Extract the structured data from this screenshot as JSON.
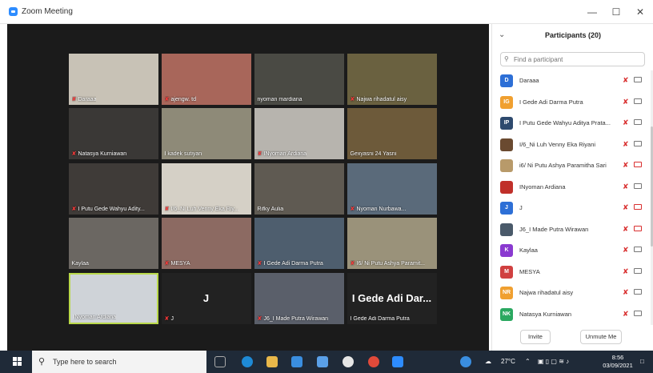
{
  "window": {
    "title": "Zoom Meeting",
    "minimize": "—",
    "maximize": "☐",
    "close": "✕"
  },
  "tiles": [
    {
      "name": "Daraaa",
      "muted": true,
      "bg": "#c8c2b6"
    },
    {
      "name": "ajengw. td",
      "muted": true,
      "bg": "#a8665a"
    },
    {
      "name": "nyoman mardiana",
      "muted": false,
      "bg": "#4a4a44"
    },
    {
      "name": "Najwa rihadatul aisy",
      "muted": true,
      "bg": "#6a6140"
    },
    {
      "name": "Natasya Kurniawan",
      "muted": true,
      "bg": "#3a3836"
    },
    {
      "name": "I kadek sutiyan",
      "muted": false,
      "bg": "#8e8a78"
    },
    {
      "name": "INyoman Ardiana",
      "muted": true,
      "bg": "#b7b4ae"
    },
    {
      "name": "Gexyasni 24 Yasni",
      "muted": false,
      "bg": "#6d5a3a"
    },
    {
      "name": "I Putu Gede Wahyu Adity...",
      "muted": true,
      "bg": "#3f3b38"
    },
    {
      "name": "I/6_Ni Luh Venny Eka Riy...",
      "muted": true,
      "bg": "#d5d0c6"
    },
    {
      "name": "Rifky Aulia",
      "muted": false,
      "bg": "#5f5a52"
    },
    {
      "name": "Nyoman Nurbawa...",
      "muted": true,
      "bg": "#5a6a7a"
    },
    {
      "name": "Kaylaa",
      "muted": false,
      "bg": "#6b6762"
    },
    {
      "name": "MESYA",
      "muted": true,
      "bg": "#8c6a62"
    },
    {
      "name": "I Gede Adi Darma Putra",
      "muted": true,
      "bg": "#4e5e6e"
    },
    {
      "name": "I6/ Ni Putu Ashya Paramit...",
      "muted": true,
      "bg": "#9a927a"
    },
    {
      "name": "INyoman Ardiana",
      "muted": false,
      "bg": "#cfd3d8",
      "active": true
    },
    {
      "name": "J",
      "muted": true,
      "bg": "#222222",
      "big": "J"
    },
    {
      "name": "J6_I Made Putra Wirawan",
      "muted": true,
      "bg": "#5a5f6a"
    },
    {
      "name": "I Gede Adi Darma Putra",
      "muted": false,
      "bg": "#222222",
      "big": "I Gede Adi Dar..."
    }
  ],
  "panel": {
    "collapse": "⌄",
    "title": "Participants (20)",
    "search_placeholder": "Find a participant",
    "invite": "Invite",
    "unmute_me": "Unmute Me"
  },
  "participants": [
    {
      "initials": "D",
      "name": "Daraaa",
      "color": "#2d6fd6",
      "cam_off": false
    },
    {
      "initials": "IG",
      "name": "I Gede Adi Darma Putra",
      "color": "#f0a030",
      "cam_off": false
    },
    {
      "initials": "IP",
      "name": "I Putu Gede Wahyu Aditya Prata...",
      "color": "#2e4a6e",
      "cam_off": false
    },
    {
      "initials": "",
      "name": "I/6_Ni Luh Venny Eka Riyani",
      "color": "#6a4a30",
      "cam_off": false
    },
    {
      "initials": "",
      "name": "i6/ Ni Putu Ashya Paramitha Sari",
      "color": "#b89a6a",
      "cam_off": true
    },
    {
      "initials": "",
      "name": "INyoman Ardiana",
      "color": "#c0302a",
      "cam_off": false
    },
    {
      "initials": "J",
      "name": "J",
      "color": "#2d6fd6",
      "cam_off": true
    },
    {
      "initials": "",
      "name": "J6_I Made Putra Wirawan",
      "color": "#4a5a6a",
      "cam_off": true
    },
    {
      "initials": "K",
      "name": "Kaylaa",
      "color": "#8a3ad0",
      "cam_off": false
    },
    {
      "initials": "M",
      "name": "MESYA",
      "color": "#d04040",
      "cam_off": false
    },
    {
      "initials": "NR",
      "name": "Najwa rihadatul aisy",
      "color": "#f0a030",
      "cam_off": false
    },
    {
      "initials": "NK",
      "name": "Natasya Kurniawan",
      "color": "#2aa860",
      "cam_off": false
    }
  ],
  "taskbar": {
    "search_placeholder": "Type here to search",
    "weather": "27°C",
    "time": "8:56",
    "date": "03/09/2021"
  },
  "colors": {
    "zoom_blue": "#2d8cff",
    "active_speaker": "#b9d84a",
    "muted_red": "#d93030"
  }
}
